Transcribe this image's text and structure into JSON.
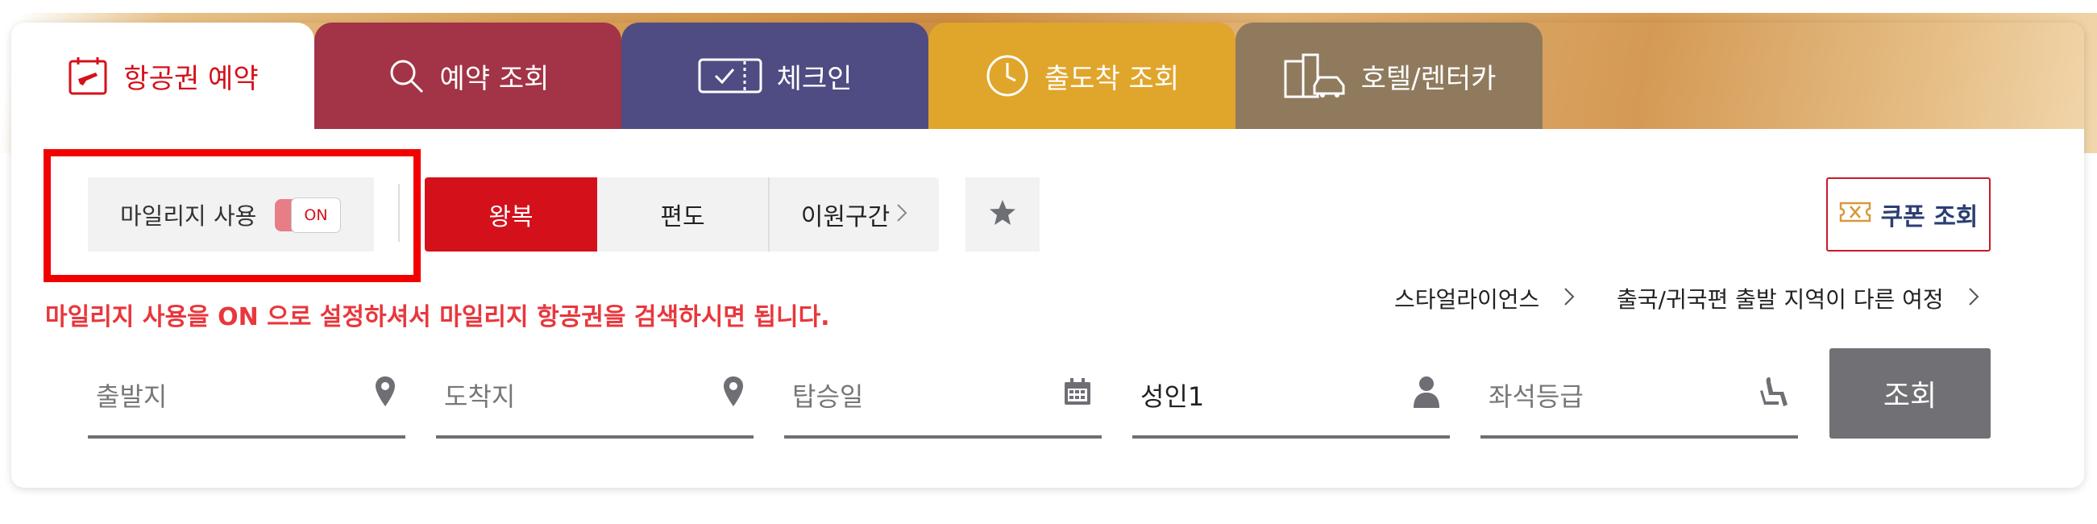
{
  "tabs": [
    {
      "label": "항공권 예약",
      "icon": "flight-ticket-icon"
    },
    {
      "label": "예약 조회",
      "icon": "search-icon"
    },
    {
      "label": "체크인",
      "icon": "boarding-pass-icon"
    },
    {
      "label": "출도착 조회",
      "icon": "clock-icon"
    },
    {
      "label": "호텔/렌터카",
      "icon": "hotel-car-icon"
    }
  ],
  "options": {
    "mileage_label": "마일리지 사용",
    "mileage_toggle": "ON",
    "trip_types": [
      "왕복",
      "편도",
      "이원구간"
    ],
    "coupon_label": "쿠폰 조회"
  },
  "notice": "마일리지 사용을 ON 으로 설정하셔서 마일리지 항공권을 검색하시면 됩니다.",
  "links": {
    "alliance": "스타얼라이언스",
    "multi_region": "출국/귀국편 출발 지역이 다른 여정"
  },
  "form": {
    "origin_placeholder": "출발지",
    "destination_placeholder": "도착지",
    "date_placeholder": "탑승일",
    "passengers": "성인1",
    "class_placeholder": "좌석등급",
    "search_label": "조회"
  },
  "colors": {
    "accent": "#d4111b",
    "tab_reserve": "#a33346",
    "tab_checkin": "#4e4c82",
    "tab_status": "#e0a52b",
    "tab_hotel": "#8f7a5d",
    "highlight_box": "#f20000"
  }
}
